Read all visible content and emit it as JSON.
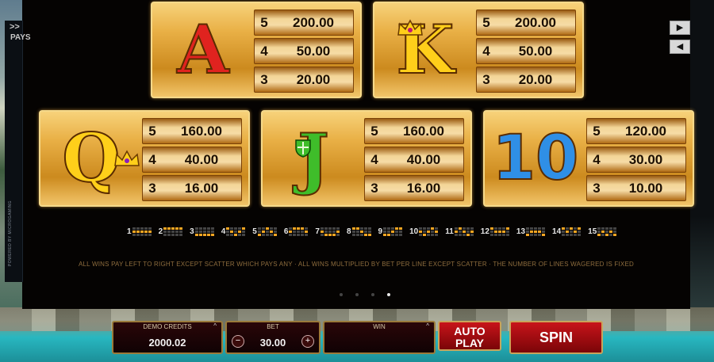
{
  "side_tab": {
    "chevron": ">>",
    "label": "PAYS",
    "credit": "POWERED BY MICROGAMING"
  },
  "nav": {
    "next": "▶",
    "prev": "◀"
  },
  "cards": [
    {
      "symbol": "A",
      "pays": [
        {
          "count": "5",
          "amount": "200.00"
        },
        {
          "count": "4",
          "amount": "50.00"
        },
        {
          "count": "3",
          "amount": "20.00"
        }
      ]
    },
    {
      "symbol": "K",
      "pays": [
        {
          "count": "5",
          "amount": "200.00"
        },
        {
          "count": "4",
          "amount": "50.00"
        },
        {
          "count": "3",
          "amount": "20.00"
        }
      ]
    },
    {
      "symbol": "Q",
      "pays": [
        {
          "count": "5",
          "amount": "160.00"
        },
        {
          "count": "4",
          "amount": "40.00"
        },
        {
          "count": "3",
          "amount": "16.00"
        }
      ]
    },
    {
      "symbol": "J",
      "pays": [
        {
          "count": "5",
          "amount": "160.00"
        },
        {
          "count": "4",
          "amount": "40.00"
        },
        {
          "count": "3",
          "amount": "16.00"
        }
      ]
    },
    {
      "symbol": "10",
      "pays": [
        {
          "count": "5",
          "amount": "120.00"
        },
        {
          "count": "4",
          "amount": "30.00"
        },
        {
          "count": "3",
          "amount": "10.00"
        }
      ]
    }
  ],
  "paylines": [
    "1",
    "2",
    "3",
    "4",
    "5",
    "6",
    "7",
    "8",
    "9",
    "10",
    "11",
    "12",
    "13",
    "14",
    "15"
  ],
  "rules": "ALL WINS PAY LEFT TO RIGHT EXCEPT SCATTER WHICH PAYS ANY   ·   ALL WINS MULTIPLIED BY BET PER LINE EXCEPT SCATTER   ·   THE NUMBER OF LINES WAGERED IS FIXED",
  "pagination": {
    "total": 4,
    "active_index": 3
  },
  "bottom_bar": {
    "credits_label": "DEMO CREDITS",
    "credits_value": "2000.02",
    "bet_label": "BET",
    "bet_value": "30.00",
    "minus": "−",
    "plus": "+",
    "win_label": "WIN",
    "win_value": "",
    "autoplay_label_1": "AUTO",
    "autoplay_label_2": "PLAY",
    "spin_label": "SPIN",
    "caret": "^"
  },
  "colors": {
    "payline_on": "#f5a623",
    "card_gold": "#e9b046",
    "spin_red": "#c8141a"
  }
}
